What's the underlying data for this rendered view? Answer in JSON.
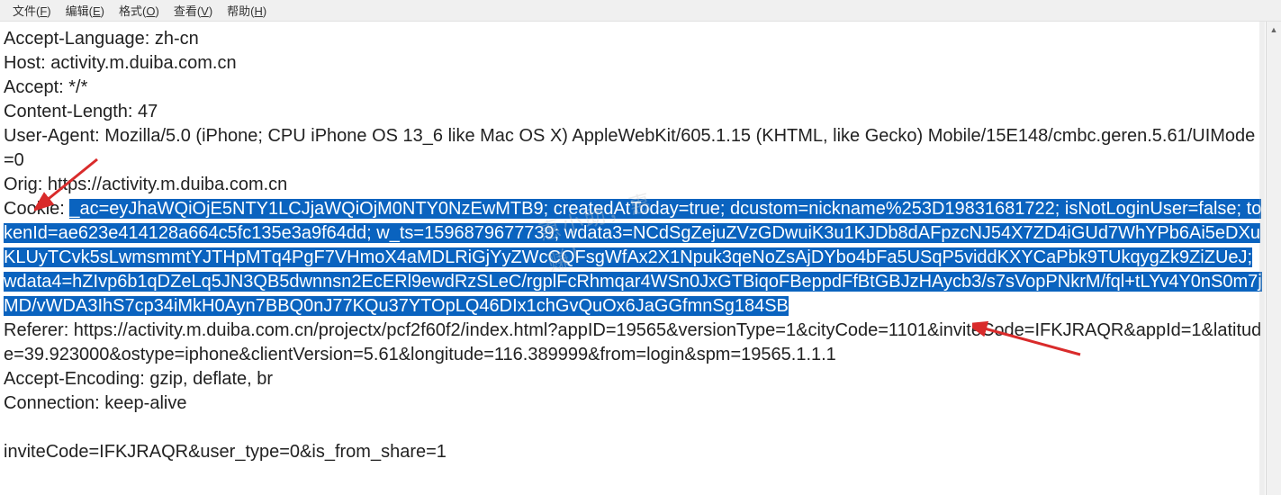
{
  "menu": {
    "file": "文件(F)",
    "edit": "编辑(E)",
    "format": "格式(O)",
    "view": "查看(V)",
    "help": "帮助(H)"
  },
  "watermark": "惠小助，惠赚！",
  "headers": {
    "accept_language": "Accept-Language: zh-cn",
    "host": "Host: activity.m.duiba.com.cn",
    "accept": "Accept: */*",
    "content_length": "Content-Length: 47",
    "user_agent": "User-Agent: Mozilla/5.0 (iPhone; CPU iPhone OS 13_6 like Mac OS X) AppleWebKit/605.1.15 (KHTML, like Gecko) Mobile/15E148/cmbc.geren.5.61/UIMode=0",
    "origin_pre": "Orig",
    "origin_post": ": https://activity.m.duiba.com.cn",
    "cookie_label": "Cookie: ",
    "cookie_sel1": "_ac=eyJhaWQiOjE5NTY1LCJjaWQiOjM0NTY0NzEwMTB9; createdAtToday=true; dcustom=nickname%253D19831681722; isNotLoginUser=false; tokenId=ae623e414128a664c5fc135e3a9f64dd; w_ts=1596879677739; wdata3=NCdSgZejuZVzGDwuiK3u1KJDb8dAFpzcNJ54X7ZD4iGUd7WhYPb6Ai5eDXuKLUyTCvk5sLwmsmmtYJTHpMTq4PgF7VHmoX4aMDLRiGjYyZWcCQFsgWfAx2X1Npuk3qeNoZsAjDYbo4bFa5USqP5viddKXYCaPbk9TUkqygZk9ZiZUeJ;",
    "cookie_mid": " ",
    "cookie_sel2": "wdata4=hZIvp6b1qDZeLq5JN3QB5dwnnsn2EcERl9ewdRzSLeC/rgplFcRhmqar4WSn0JxGTBiqoFBeppdFfBtGBJzHAycb3/s7sVopPNkrM/fql+tLYv4Y0nS0m7jMD/vWDA3IhS7cp34iMkH0Ayn7BBQ0nJ77KQu37YTOpLQ46DIx1chGvQuOx6JaGGfmnSg184SB",
    "referer": "Referer: https://activity.m.duiba.com.cn/projectx/pcf2f60f2/index.html?appID=19565&versionType=1&cityCode=1101&inviteCode=IFKJRAQR&appId=1&latitude=39.923000&ostype=iphone&clientVersion=5.61&longitude=116.389999&from=login&spm=19565.1.1.1",
    "accept_encoding": "Accept-Encoding: gzip, deflate, br",
    "connection": "Connection: keep-alive",
    "trailing": "inviteCode=IFKJRAQR&user_type=0&is_from_share=1"
  }
}
